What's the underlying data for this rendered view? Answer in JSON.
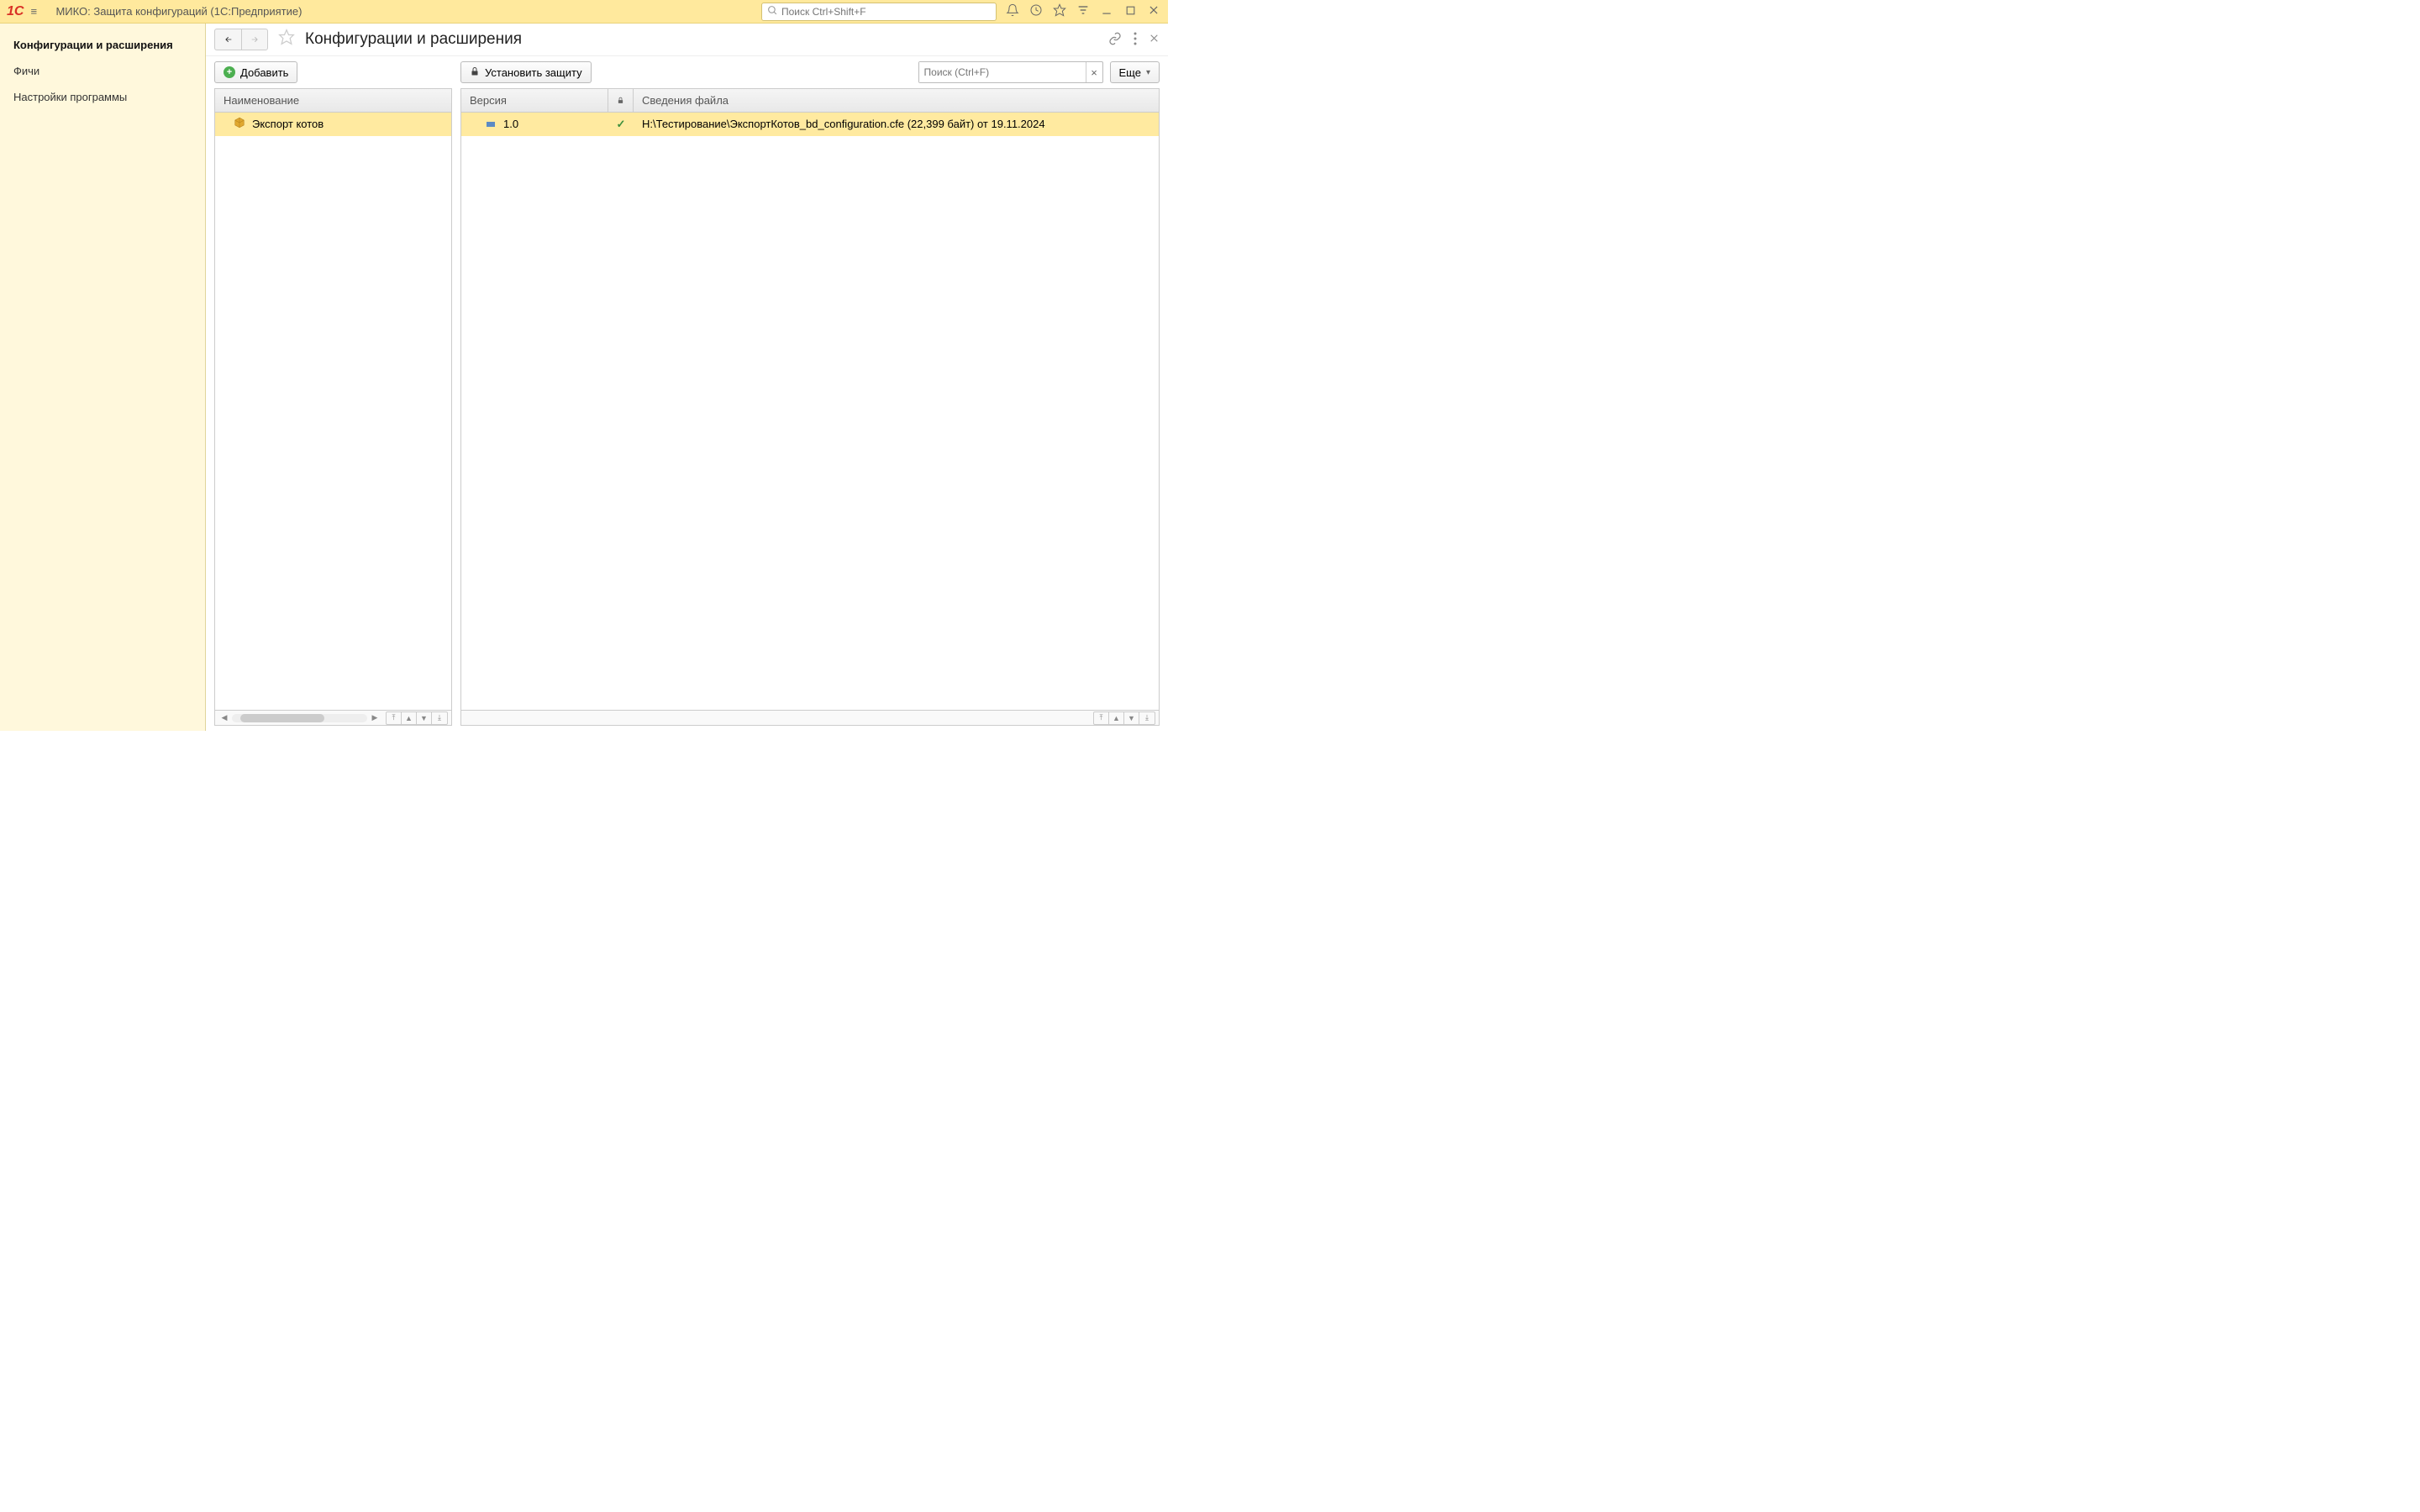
{
  "titlebar": {
    "app_title": "МИКО: Защита конфигураций  (1С:Предприятие)",
    "search_placeholder": "Поиск Ctrl+Shift+F"
  },
  "sidebar": {
    "items": [
      {
        "label": "Конфигурации и расширения",
        "active": true
      },
      {
        "label": "Фичи",
        "active": false
      },
      {
        "label": "Настройки программы",
        "active": false
      }
    ]
  },
  "page": {
    "title": "Конфигурации и расширения"
  },
  "toolbar": {
    "add_label": "Добавить",
    "protect_label": "Установить защиту",
    "search_placeholder": "Поиск (Ctrl+F)",
    "more_label": "Еще"
  },
  "left_table": {
    "header": "Наименование",
    "rows": [
      {
        "name": "Экспорт котов"
      }
    ]
  },
  "right_table": {
    "headers": {
      "version": "Версия",
      "file_info": "Сведения файла"
    },
    "rows": [
      {
        "version": "1.0",
        "locked": true,
        "file_info": "H:\\Тестирование\\ЭкспортКотов_bd_configuration.cfe (22,399 байт) от 19.11.2024"
      }
    ]
  }
}
